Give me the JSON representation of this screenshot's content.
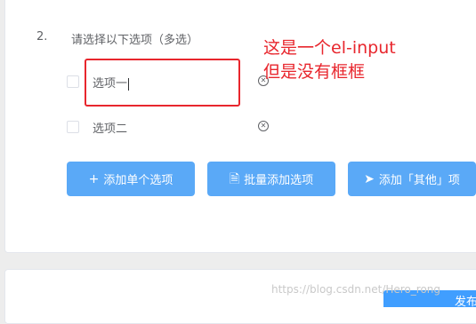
{
  "question": {
    "number": "2.",
    "title": "请选择以下选项（多选）",
    "options": [
      {
        "label": "选项一"
      },
      {
        "label": "选项二"
      }
    ],
    "delete_icon": "circle-x-icon"
  },
  "annotation": {
    "line1": "这是一个el-input",
    "line2": "但是没有框框",
    "color": "#e8262d"
  },
  "buttons": [
    {
      "label": "添加单个选项",
      "icon": "plus-icon",
      "glyph": "+"
    },
    {
      "label": "批量添加选项",
      "icon": "document-add-icon",
      "glyph": "🗎"
    },
    {
      "label": "添加「其他」项",
      "icon": "send-icon",
      "glyph": "➤"
    }
  ],
  "watermark": "https://blog.csdn.net/Hero_rong",
  "publish_button": {
    "label": "发布"
  },
  "colors": {
    "button_bg": "#5aa9f7",
    "primary": "#409eff"
  }
}
